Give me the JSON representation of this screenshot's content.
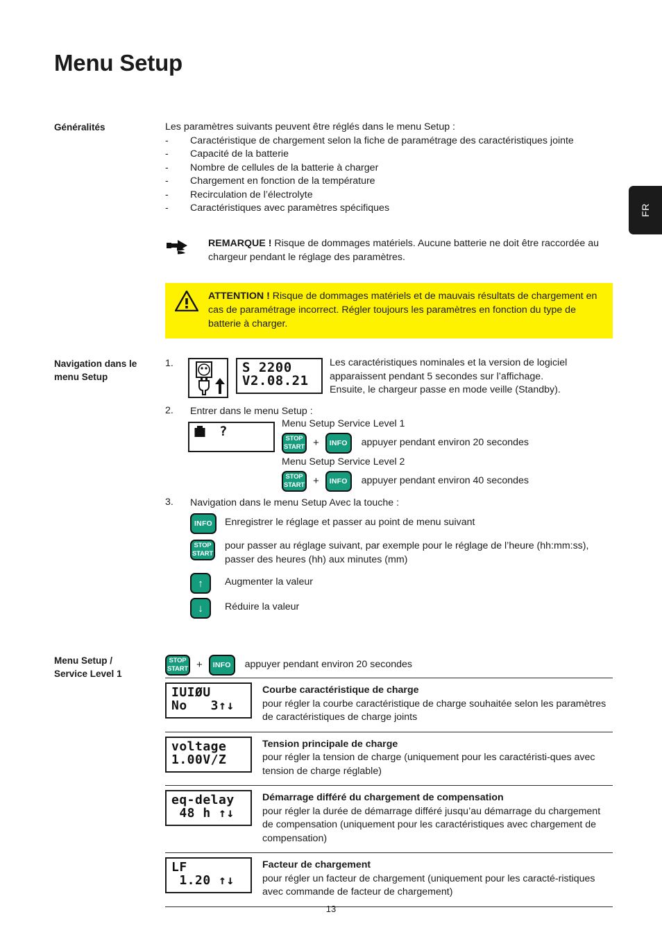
{
  "page": {
    "title": "Menu Setup",
    "language_tab": "FR",
    "page_number": "13"
  },
  "general": {
    "margin_label": "Généralités",
    "intro": "Les paramètres suivants peuvent être réglés dans le menu Setup :",
    "bullet_marker": "-",
    "bullets": [
      "Caractéristique de chargement selon la fiche de paramétrage des caractéristiques jointe",
      "Capacité de la batterie",
      "Nombre de cellules de la batterie à charger",
      "Chargement en fonction de la température",
      "Recirculation de l’électrolyte",
      "Caractéristiques avec paramètres spécifiques"
    ]
  },
  "note": {
    "icon": "pointing-hand-icon",
    "keyword": "REMARQUE !",
    "text": " Risque de dommages matériels. Aucune batterie ne doit être raccordée au chargeur pendant le réglage des paramètres."
  },
  "caution": {
    "icon": "warning-triangle-icon",
    "keyword": "ATTENTION !",
    "text": " Risque de dommages matériels et de mauvais résultats de chargement en cas de paramétrage incorrect. Régler toujours les paramètres en fonction du type de batterie à charger.",
    "background_color": "#fff200"
  },
  "navigation": {
    "margin_label": "Navigation dans le menu Setup",
    "step1": {
      "number": "1.",
      "plug_icon": "power-socket-plug-icon",
      "lcd": {
        "line1": "S 2200",
        "line2": "V2.08.21"
      },
      "text_line1": "Les caractéristiques nominales et la version de logiciel",
      "text_line2": "apparaissent pendant 5 secondes sur l’affichage.",
      "text_line3": "Ensuite, le chargeur passe en mode veille (Standby)."
    },
    "step2": {
      "number": "2.",
      "text": "Entrer dans le menu Setup :",
      "lcd": {
        "line1": "▓ ?",
        "line2": ""
      },
      "level1_label": "Menu Setup Service Level 1",
      "level1_keys": {
        "stop": "STOP",
        "start": "START",
        "plus": "+",
        "info": "INFO"
      },
      "level1_text": "appuyer pendant environ 20 secondes",
      "level2_label": "Menu Setup Service Level 2",
      "level2_text": "appuyer pendant environ 40 secondes"
    },
    "step3": {
      "number": "3.",
      "text": "Navigation dans le menu Setup Avec la touche :",
      "rows": [
        {
          "key": "INFO",
          "key_name": "info-key",
          "text": "Enregistrer le réglage et passer au point de menu suivant"
        },
        {
          "key": "STOP/START",
          "key_name": "stop-start-key",
          "text": "pour passer au réglage suivant, par exemple pour le réglage de l’heure (hh:mm:ss), passer des heures (hh) aux minutes (mm)"
        },
        {
          "key": "↑",
          "key_name": "up-arrow-key",
          "text": "Augmenter la valeur"
        },
        {
          "key": "↓",
          "key_name": "down-arrow-key",
          "text": "Réduire la valeur"
        }
      ]
    }
  },
  "service_level_1": {
    "margin_label": "Menu Setup / Service Level 1",
    "margin_label_line1": "Menu Setup /",
    "margin_label_line2": "Service Level 1",
    "keys_text": "appuyer pendant environ 20 secondes",
    "rows": [
      {
        "lcd_line1": "IUIØU",
        "lcd_line2": "No   3↑↓",
        "title": "Courbe caractéristique de charge",
        "description": "pour régler la courbe caractéristique de charge souhaitée selon les paramètres de caractéristiques de charge joints"
      },
      {
        "lcd_line1": "voltage",
        "lcd_line2": "1.00V/Z",
        "title": "Tension principale de charge",
        "description": "pour régler la tension de charge (uniquement pour les caractéristi-ques avec tension de charge réglable)"
      },
      {
        "lcd_line1": "eq-delay",
        "lcd_line2": " 48 h ↑↓",
        "title": "Démarrage différé du chargement de compensation",
        "description": "pour régler la durée de démarrage différé jusqu’au démarrage du chargement de compensation (uniquement pour les caractéristiques avec chargement de compensation)"
      },
      {
        "lcd_line1": "LF",
        "lcd_line2": " 1.20 ↑↓",
        "title": "Facteur de chargement",
        "description": "pour régler un facteur de chargement (uniquement pour les caracté-ristiques avec commande de facteur de chargement)"
      }
    ]
  },
  "keys": {
    "stop": "STOP",
    "start": "START",
    "info": "INFO",
    "plus": "+",
    "up": "↑",
    "down": "↓"
  },
  "colors": {
    "key_green": "#149C7C",
    "caution_yellow": "#fff200",
    "tab_black": "#1b1b1b"
  }
}
